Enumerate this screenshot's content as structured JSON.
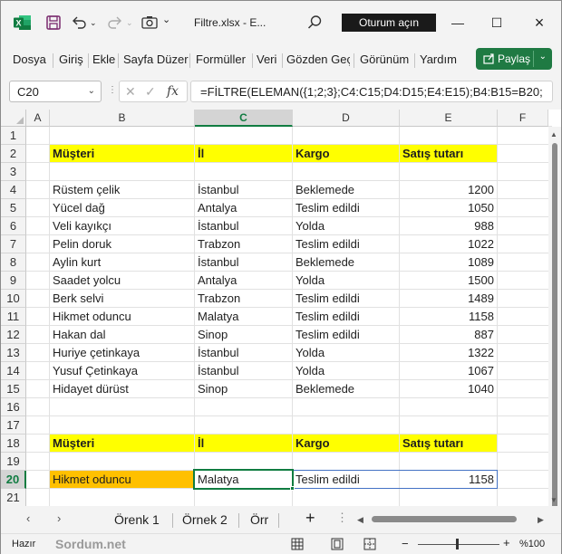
{
  "titlebar": {
    "filename": "Filtre.xlsx  -  E...",
    "signin_label": "Oturum açın"
  },
  "ribbon": {
    "tabs": [
      "Dosya",
      "Giriş",
      "Ekle",
      "Sayfa Düzer",
      "Formüller",
      "Veri",
      "Gözden Geç",
      "Görünüm",
      "Yardım"
    ],
    "share_label": "Paylaş"
  },
  "formula_bar": {
    "name_box": "C20",
    "formula": "=FİLTRE(ELEMAN({1;2;3};C4:C15;D4:D15;E4:E15);B4:B15=B20;"
  },
  "grid": {
    "columns": [
      "A",
      "B",
      "C",
      "D",
      "E",
      "F"
    ],
    "rows": [
      "1",
      "2",
      "3",
      "4",
      "5",
      "6",
      "7",
      "8",
      "9",
      "10",
      "11",
      "12",
      "13",
      "14",
      "15",
      "16",
      "17",
      "18",
      "19",
      "20",
      "21"
    ],
    "header_row": {
      "musteri": "Müşteri",
      "il": "İl",
      "kargo": "Kargo",
      "satis": "Satış tutarı"
    },
    "data": [
      {
        "musteri": "Rüstem çelik",
        "il": "İstanbul",
        "kargo": "Beklemede",
        "satis": "1200"
      },
      {
        "musteri": "Yücel dağ",
        "il": "Antalya",
        "kargo": "Teslim edildi",
        "satis": "1050"
      },
      {
        "musteri": "Veli kayıkçı",
        "il": "İstanbul",
        "kargo": "Yolda",
        "satis": "988"
      },
      {
        "musteri": "Pelin doruk",
        "il": "Trabzon",
        "kargo": "Teslim edildi",
        "satis": "1022"
      },
      {
        "musteri": "Aylin kurt",
        "il": "İstanbul",
        "kargo": "Beklemede",
        "satis": "1089"
      },
      {
        "musteri": "Saadet yolcu",
        "il": "Antalya",
        "kargo": "Yolda",
        "satis": "1500"
      },
      {
        "musteri": "Berk selvi",
        "il": "Trabzon",
        "kargo": "Teslim edildi",
        "satis": "1489"
      },
      {
        "musteri": "Hikmet oduncu",
        "il": "Malatya",
        "kargo": "Teslim edildi",
        "satis": "1158"
      },
      {
        "musteri": "Hakan dal",
        "il": "Sinop",
        "kargo": "Teslim edildi",
        "satis": "887"
      },
      {
        "musteri": "Huriye çetinkaya",
        "il": "İstanbul",
        "kargo": "Yolda",
        "satis": "1322"
      },
      {
        "musteri": "Yusuf Çetinkaya",
        "il": "İstanbul",
        "kargo": "Yolda",
        "satis": "1067"
      },
      {
        "musteri": "Hidayet dürüst",
        "il": "Sinop",
        "kargo": "Beklemede",
        "satis": "1040"
      }
    ],
    "lookup_header": {
      "musteri": "Müşteri",
      "il": "İl",
      "kargo": "Kargo",
      "satis": "Satış tutarı"
    },
    "lookup_row": {
      "musteri": "Hikmet oduncu",
      "il": "Malatya",
      "kargo": "Teslim edildi",
      "satis": "1158"
    }
  },
  "sheets": {
    "tabs": [
      "Örenk 1",
      "Örnek 2",
      "Örr"
    ],
    "add_label": "+"
  },
  "status": {
    "ready": "Hazır",
    "watermark": "Sordum.net",
    "zoom": "%100"
  },
  "colors": {
    "header_fill": "#ffff00",
    "lookup_fill": "#ffc000",
    "excel_green": "#107c41",
    "share_green": "#1f7a43"
  }
}
